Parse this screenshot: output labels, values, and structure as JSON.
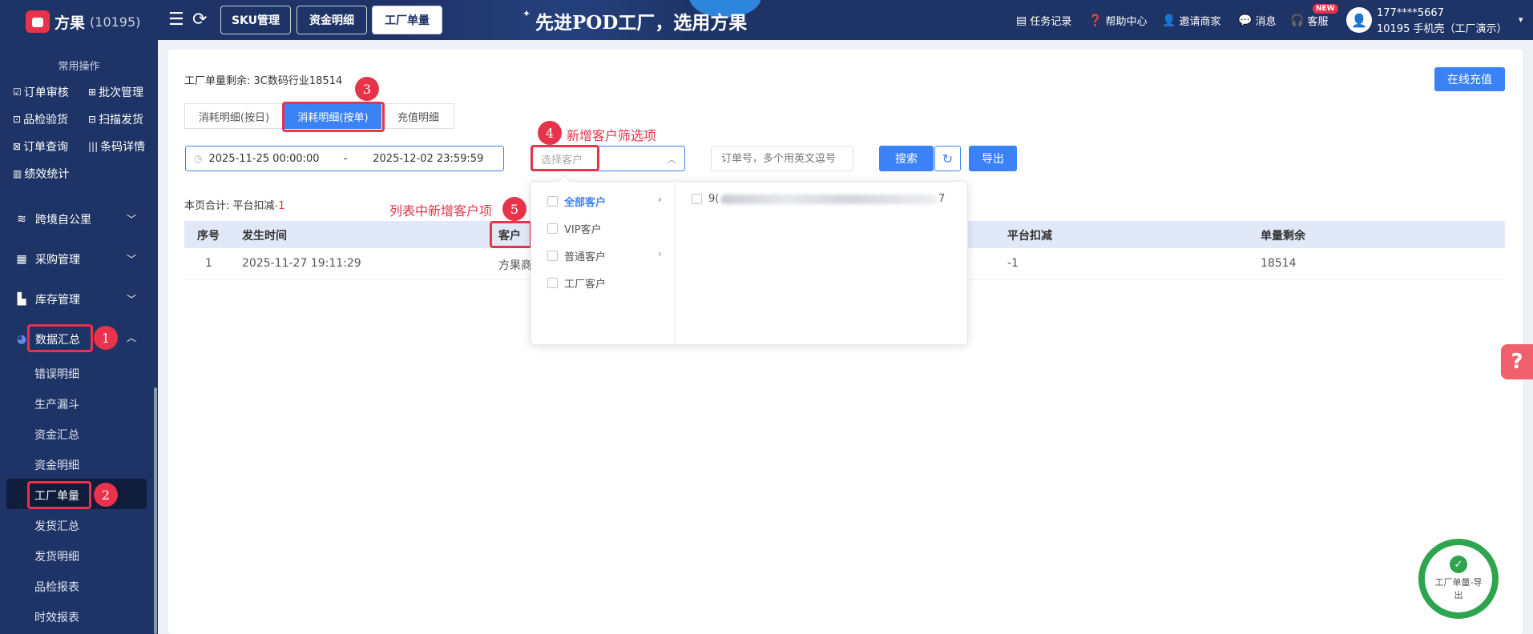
{
  "app": {
    "brand": "方果",
    "brand_id": "(10195)",
    "slogan": "先进POD工厂，选用方果"
  },
  "top_tabs": [
    "SKU管理",
    "资金明细",
    "工厂单量"
  ],
  "top_links": {
    "tasks": "任务记录",
    "help": "帮助中心",
    "invite": "邀请商家",
    "messages": "消息",
    "service": "客服",
    "new_badge": "NEW"
  },
  "user": {
    "phone": "177****5667",
    "org": "10195 手机壳（工厂演示）"
  },
  "sidebar": {
    "section_title": "常用操作",
    "quick": [
      "订单审核",
      "批次管理",
      "品检验货",
      "扫描发货",
      "订单查询",
      "条码详情",
      "绩效统计"
    ],
    "menus": [
      "跨境自公里",
      "采购管理",
      "库存管理",
      "数据汇总"
    ],
    "sub_items": [
      "错误明细",
      "生产漏斗",
      "资金汇总",
      "资金明细",
      "工厂单量",
      "发货汇总",
      "发货明细",
      "品检报表",
      "时效报表"
    ]
  },
  "main": {
    "remain_label": "工厂单量剩余:",
    "remain_value": "3C数码行业18514",
    "recharge_button": "在线充值",
    "segments": [
      "消耗明细(按日)",
      "消耗明细(按单)",
      "充值明细"
    ],
    "date_start": "2025-11-25 00:00:00",
    "date_sep": "-",
    "date_end": "2025-12-02 23:59:59",
    "customer_placeholder": "选择客户",
    "order_placeholder": "订单号，多个用英文逗号",
    "search_button": "搜索",
    "export_button": "导出",
    "summary_label": "本页合计: 平台扣减",
    "summary_value": "-1"
  },
  "table": {
    "headers": [
      "序号",
      "发生时间",
      "客户",
      "平台扣减",
      "单量剩余"
    ],
    "rows": [
      {
        "no": "1",
        "time": "2025-11-27 19:11:29",
        "customer": "方果商",
        "deduct": "-1",
        "remain": "18514"
      }
    ]
  },
  "dropdown": {
    "options": [
      "全部客户",
      "VIP客户",
      "普通客户",
      "工厂客户"
    ],
    "right_prefix": "9(",
    "right_suffix": "7"
  },
  "annotations": {
    "n1": "1",
    "n2": "2",
    "n3": "3",
    "n4": "4",
    "n5": "5",
    "text4": "新增客户筛选项",
    "text5": "列表中新增客户项"
  },
  "float_export": {
    "text": "工厂单量-导出",
    "check": "✓"
  },
  "colors": {
    "nav_bg": "#1f3466",
    "primary": "#3b82f6",
    "annotation": "#e8334a",
    "success": "#2ea44f"
  }
}
